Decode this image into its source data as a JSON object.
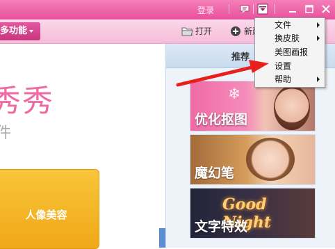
{
  "titlebar": {
    "login_label": "登录",
    "icons": [
      "message-icon",
      "menu-dropdown-icon",
      "minimize-icon",
      "maximize-icon",
      "close-icon"
    ]
  },
  "toolbar": {
    "more_functions_label": "多功能",
    "open_label": "打开",
    "new_label": "新建"
  },
  "left_pane": {
    "brand_title": "秀秀",
    "brand_subtitle": "件",
    "beauty_button_label": "人像美容"
  },
  "right_pane": {
    "header_title": "推荐",
    "cards": [
      {
        "label": "优化抠图"
      },
      {
        "label": "魔幻笔"
      },
      {
        "label": "文字特效",
        "art_text": "Good Night"
      }
    ]
  },
  "menu": {
    "items": [
      {
        "label": "文件",
        "has_submenu": true
      },
      {
        "label": "换皮肤",
        "has_submenu": true
      },
      {
        "label": "美图画报",
        "has_submenu": false
      },
      {
        "label": "设置",
        "has_submenu": false
      },
      {
        "label": "帮助",
        "has_submenu": true
      }
    ]
  },
  "colors": {
    "titlebar": "#e8509c",
    "accent_pink": "#ee6aa2",
    "annotation_arrow": "#e8201c",
    "beauty_button": "#f3b42a"
  }
}
